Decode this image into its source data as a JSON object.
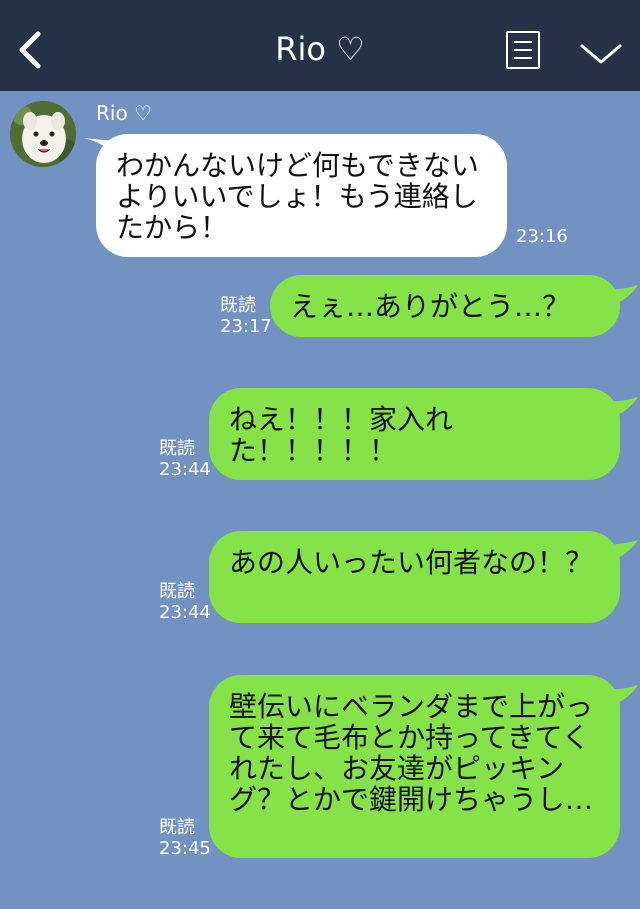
{
  "header": {
    "title": "Rio ♡"
  },
  "contact": {
    "name": "Rio ♡"
  },
  "messages": [
    {
      "side": "left",
      "text": "わかんないけど何もできないよりいいでしょ！もう連絡したから！",
      "time": "23:16"
    },
    {
      "side": "right",
      "text": "えぇ…ありがとう…？",
      "read": "既読",
      "time": "23:17"
    },
    {
      "side": "right",
      "text": "ねえ！！！家入れた！！！！！",
      "read": "既読",
      "time": "23:44"
    },
    {
      "side": "right",
      "text": "あの人いったい何者なの！？",
      "read": "既読",
      "time": "23:44"
    },
    {
      "side": "right",
      "text": "壁伝いにベランダまで上がって来て毛布とか持ってきてくれたし、お友達がピッキング？とかで鍵開けちゃうし…",
      "read": "既読",
      "time": "23:45"
    }
  ],
  "colors": {
    "header_bg": "#263247",
    "chat_bg": "#7292c2",
    "sent_bubble": "#85e249",
    "received_bubble": "#ffffff"
  },
  "icons": [
    "back-icon",
    "menu-icon",
    "chevron-down-icon"
  ]
}
